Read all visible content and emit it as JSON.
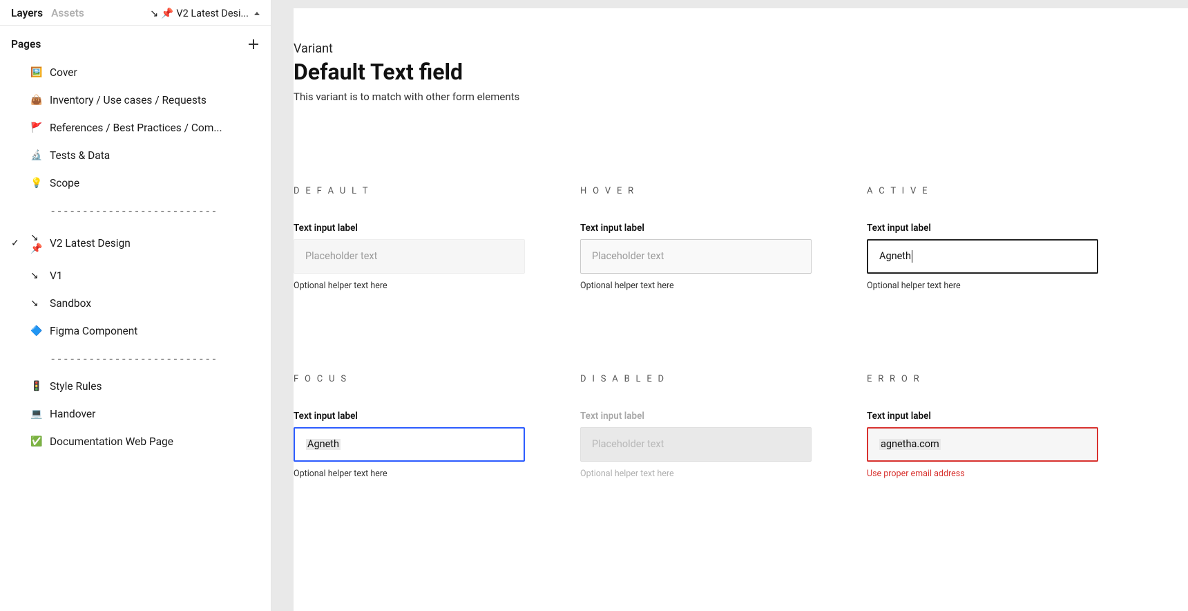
{
  "sidebar": {
    "tabs": {
      "layers": "Layers",
      "assets": "Assets"
    },
    "current_page_short": "V2 Latest Desi...",
    "pages_title": "Pages",
    "pages": [
      {
        "icon": "🖼️",
        "label": "Cover"
      },
      {
        "icon": "👜",
        "label": "Inventory / Use cases / Requests"
      },
      {
        "icon": "🚩",
        "label": "References  / Best Practices / Com..."
      },
      {
        "icon": "🔬",
        "label": "Tests & Data"
      },
      {
        "icon": "💡",
        "label": "Scope"
      },
      {
        "icon": "",
        "label": "--------------------------",
        "divider": true
      },
      {
        "icon": "↘ 📌",
        "label": "V2  Latest Design",
        "checked": true
      },
      {
        "icon": "↘",
        "label": "V1"
      },
      {
        "icon": "↘",
        "label": "Sandbox"
      },
      {
        "icon": "🔷",
        "label": "Figma Component"
      },
      {
        "icon": "",
        "label": "--------------------------",
        "divider": true
      },
      {
        "icon": "🚦",
        "label": "Style Rules"
      },
      {
        "icon": "💻",
        "label": "Handover"
      },
      {
        "icon": "✅",
        "label": "Documentation Web Page"
      }
    ]
  },
  "heading": {
    "overline": "Variant",
    "title": "Default Text field",
    "subtitle": "This variant is to match with other form elements"
  },
  "states": {
    "default": {
      "name": "D E F A U L T",
      "label": "Text input label",
      "placeholder": "Placeholder text",
      "helper": "Optional helper text here"
    },
    "hover": {
      "name": "H O V E R",
      "label": "Text input label",
      "placeholder": "Placeholder text",
      "helper": "Optional helper text here"
    },
    "active": {
      "name": "A C T I V E",
      "label": "Text input label",
      "value": "Agneth",
      "helper": "Optional helper text here"
    },
    "focus": {
      "name": "F O C U S",
      "label": "Text input label",
      "value": "Agneth",
      "helper": "Optional helper text here"
    },
    "disabled": {
      "name": "D I S A B L E D",
      "label": "Text input label",
      "placeholder": "Placeholder text",
      "helper": "Optional helper text here"
    },
    "error": {
      "name": "E R R O R",
      "label": "Text input label",
      "value": "agnetha.com",
      "helper": "Use proper email address"
    }
  }
}
